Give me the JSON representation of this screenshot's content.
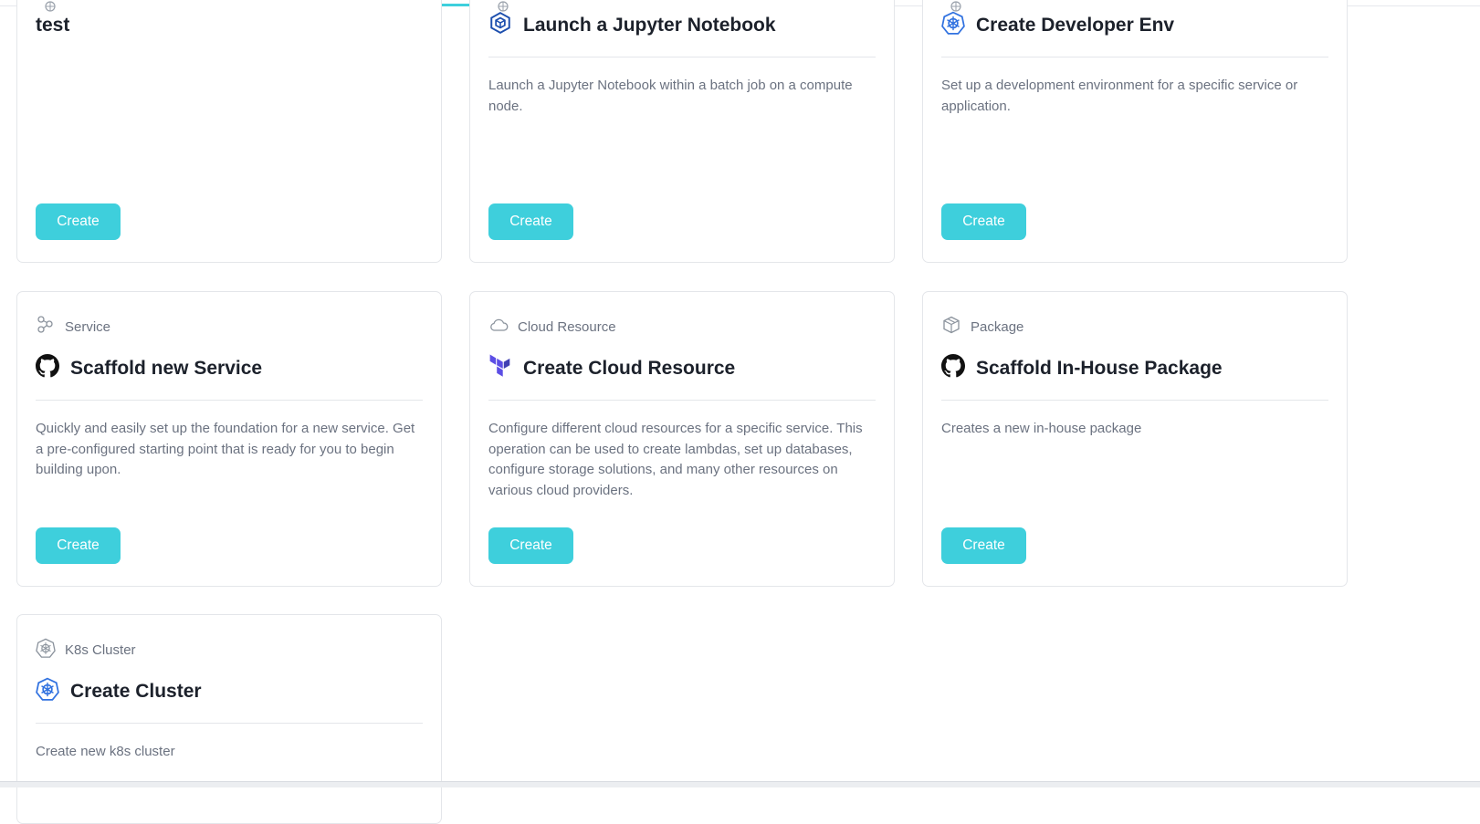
{
  "accent_color": "#3ecfdc",
  "create_label": "Create",
  "row1": [
    {
      "title": "test",
      "description": "",
      "title_icon": "none",
      "category_icon": "globe-icon"
    },
    {
      "title": "Launch a Jupyter Notebook",
      "description": "Launch a Jupyter Notebook within a batch job on a compute node.",
      "title_icon": "cube-icon",
      "category_icon": "globe-icon"
    },
    {
      "title": "Create Developer Env",
      "description": "Set up a development environment for a specific service or application.",
      "title_icon": "kubernetes-icon",
      "category_icon": "globe-icon"
    }
  ],
  "row2": [
    {
      "category": "Service",
      "category_icon": "service-icon",
      "title": "Scaffold new Service",
      "title_icon": "github-icon",
      "description": "Quickly and easily set up the foundation for a new service. Get a pre-configured starting point that is ready for you to begin building upon."
    },
    {
      "category": "Cloud Resource",
      "category_icon": "cloud-icon",
      "title": "Create Cloud Resource",
      "title_icon": "terraform-icon",
      "description": "Configure different cloud resources for a specific service. This operation can be used to create lambdas, set up databases, configure storage solutions, and many other resources on various cloud providers."
    },
    {
      "category": "Package",
      "category_icon": "package-icon",
      "title": "Scaffold In-House Package",
      "title_icon": "github-icon",
      "description": "Creates a new in-house package"
    }
  ],
  "row3": [
    {
      "category": "K8s Cluster",
      "category_icon": "k8s-icon",
      "title": "Create Cluster",
      "title_icon": "kubernetes-icon",
      "description": "Create new k8s cluster"
    }
  ]
}
